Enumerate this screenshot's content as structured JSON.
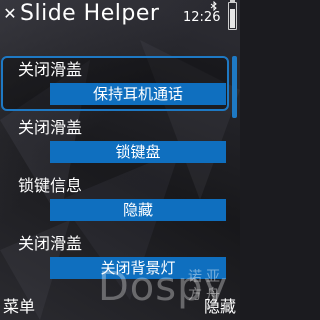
{
  "header": {
    "title": "Slide Helper",
    "clock": "12:26",
    "icons": {
      "close": "close-x-icon",
      "bluetooth": "bluetooth-icon",
      "battery": "battery-icon"
    },
    "battery_level_fraction": 0.8
  },
  "list": {
    "items": [
      {
        "label": "关闭滑盖",
        "value": "保持耳机通话",
        "selected": true
      },
      {
        "label": "关闭滑盖",
        "value": "锁键盘",
        "selected": false
      },
      {
        "label": "锁键信息",
        "value": "隐藏",
        "selected": false
      },
      {
        "label": "关闭滑盖",
        "value": "关闭背景灯",
        "selected": false
      }
    ]
  },
  "softkeys": {
    "left": "菜单",
    "right": "隐藏"
  },
  "watermark": {
    "text": "Dospy",
    "cn": "诺亚方舟"
  },
  "colors": {
    "accent": "#1e79c4",
    "value_bg": "#0f6fbf",
    "background": "#18181b"
  }
}
